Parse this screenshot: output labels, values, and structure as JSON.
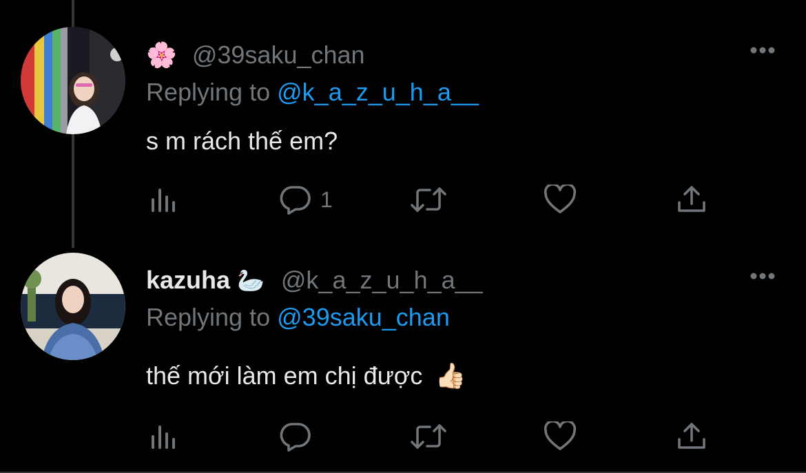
{
  "tweets": [
    {
      "display_emoji": "🌸",
      "display_name": "",
      "handle": "@39saku_chan",
      "replying_prefix": "Replying to",
      "replying_to": "@k_a_z_u_h_a__",
      "text": "s m rách thế em?",
      "reply_count": "1",
      "icons": [
        "views-icon",
        "reply-icon",
        "retweet-icon",
        "like-icon",
        "share-icon"
      ]
    },
    {
      "display_name": "kazuha",
      "display_emoji": "🦢",
      "handle": "@k_a_z_u_h_a__",
      "replying_prefix": "Replying to",
      "replying_to": "@39saku_chan",
      "text": "thế mới làm em chị được",
      "text_emoji": "👍🏻",
      "reply_count": "",
      "icons": [
        "views-icon",
        "reply-icon",
        "retweet-icon",
        "like-icon",
        "share-icon"
      ]
    }
  ],
  "colors": {
    "background": "#000000",
    "text": "#e7e9ea",
    "secondary": "#71767b",
    "link": "#1d9bf0",
    "thread_line": "#333639"
  }
}
